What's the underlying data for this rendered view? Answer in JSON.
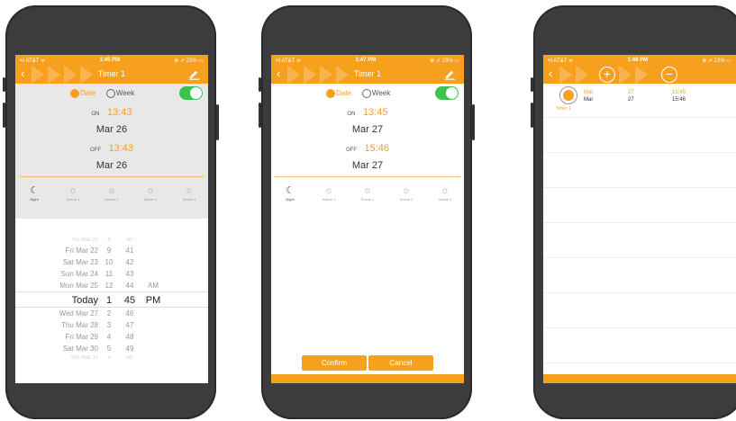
{
  "colors": {
    "accent": "#f7a01e",
    "toggle_on": "#3cc24f",
    "phone_body": "#3c3c3e"
  },
  "phone1": {
    "status": {
      "carrier": "•ıl AT&T ᯤ",
      "time": "1:45 PM",
      "right": "⊕ ⇗ 23% ▭"
    },
    "nav": {
      "title": "Timer 1",
      "back_icon": "back-chevron",
      "action_icon": "pencil-icon"
    },
    "mode": {
      "date_label": "Date",
      "week_label": "Week",
      "selected": "Date",
      "enabled": true
    },
    "on_tag": "ON",
    "on_time": "13:43",
    "on_date": "Mar 26",
    "off_tag": "OFF",
    "off_time": "13:43",
    "off_date": "Mar 26",
    "scenes": [
      "Night",
      "Scene 1",
      "Scene 2",
      "Scene 3",
      "Scene 4"
    ],
    "picker": {
      "rows": [
        {
          "date": "Thu Mar 21",
          "hour": "8",
          "min": "40",
          "ampm": ""
        },
        {
          "date": "Fri Mar 22",
          "hour": "9",
          "min": "41",
          "ampm": ""
        },
        {
          "date": "Sat Mar 23",
          "hour": "10",
          "min": "42",
          "ampm": ""
        },
        {
          "date": "Sun Mar 24",
          "hour": "11",
          "min": "43",
          "ampm": ""
        },
        {
          "date": "Mon Mar 25",
          "hour": "12",
          "min": "44",
          "ampm": "AM"
        },
        {
          "date": "Today",
          "hour": "1",
          "min": "45",
          "ampm": "PM"
        },
        {
          "date": "Wed Mar 27",
          "hour": "2",
          "min": "46",
          "ampm": ""
        },
        {
          "date": "Thu Mar 28",
          "hour": "3",
          "min": "47",
          "ampm": ""
        },
        {
          "date": "Fri Mar 29",
          "hour": "4",
          "min": "48",
          "ampm": ""
        },
        {
          "date": "Sat Mar 30",
          "hour": "5",
          "min": "49",
          "ampm": ""
        },
        {
          "date": "Sun Mar 31",
          "hour": "6",
          "min": "50",
          "ampm": ""
        }
      ],
      "selected_index": 5
    }
  },
  "phone2": {
    "status": {
      "carrier": "•ıl AT&T ᯤ",
      "time": "1:47 PM",
      "right": "⊕ ⇗ 23% ▭"
    },
    "nav": {
      "title": "Timer 1",
      "back_icon": "back-chevron",
      "action_icon": "pencil-icon"
    },
    "mode": {
      "date_label": "Date",
      "week_label": "Week",
      "selected": "Date",
      "enabled": true
    },
    "on_tag": "ON",
    "on_time": "13:45",
    "on_date": "Mar 27",
    "off_tag": "OFF",
    "off_time": "15:46",
    "off_date": "Mar 27",
    "scenes": [
      "Night",
      "Scene 1",
      "Scene 2",
      "Scene 3",
      "Scene 4"
    ],
    "confirm_label": "Confirm",
    "cancel_label": "Cancel"
  },
  "phone3": {
    "status": {
      "carrier": "•ıl AT&T ᯤ",
      "time": "1:48 PM",
      "right": "⊕ ⇗ 23% ▭"
    },
    "nav": {
      "back_icon": "back-chevron",
      "add_icon": "plus-circle-icon",
      "remove_icon": "minus-circle-icon"
    },
    "timers": [
      {
        "name": "Timer 1",
        "on_month": "Mar",
        "on_day": "27",
        "on_time": "13:45",
        "off_month": "Mar",
        "off_day": "27",
        "off_time": "15:46"
      }
    ]
  }
}
